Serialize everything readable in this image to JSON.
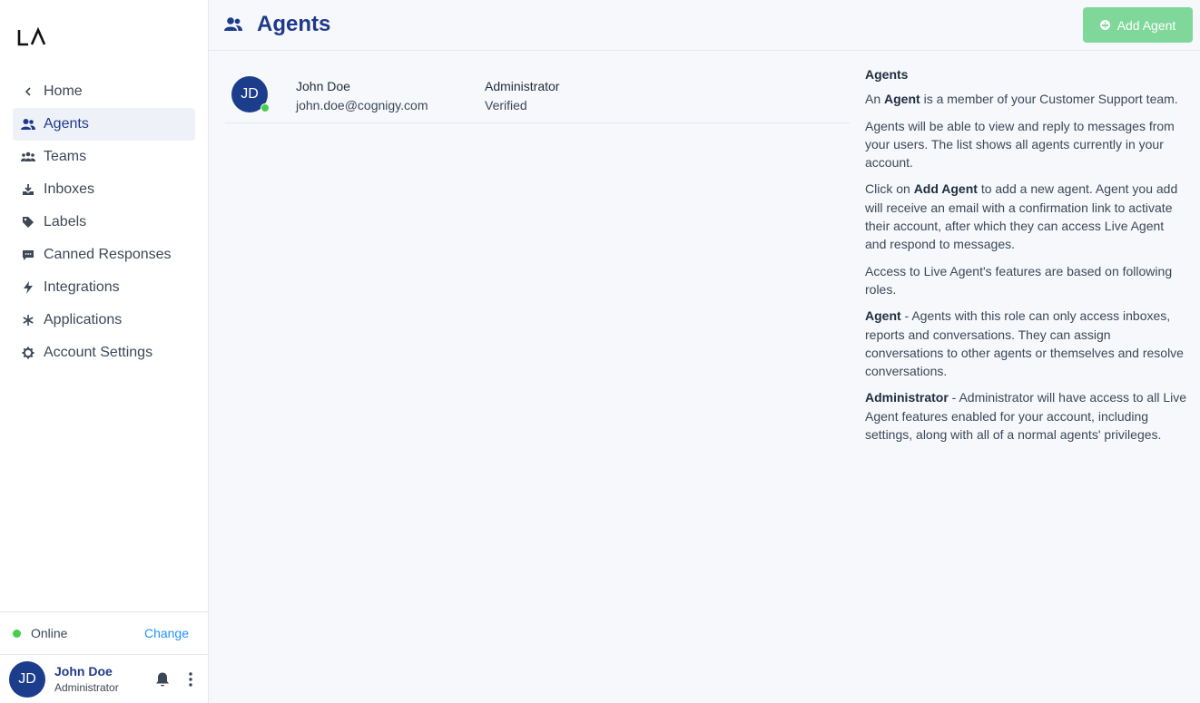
{
  "app": {
    "logo_text": "LA"
  },
  "sidebar": {
    "items": [
      {
        "label": "Home",
        "icon": "chevron-left-icon"
      },
      {
        "label": "Agents",
        "icon": "users-icon",
        "active": true
      },
      {
        "label": "Teams",
        "icon": "teams-icon"
      },
      {
        "label": "Inboxes",
        "icon": "inbox-icon"
      },
      {
        "label": "Labels",
        "icon": "tag-icon"
      },
      {
        "label": "Canned Responses",
        "icon": "chat-icon"
      },
      {
        "label": "Integrations",
        "icon": "bolt-icon"
      },
      {
        "label": "Applications",
        "icon": "asterisk-icon"
      },
      {
        "label": "Account Settings",
        "icon": "gear-icon"
      }
    ],
    "status": {
      "text": "Online",
      "change_label": "Change",
      "color": "#44ce4b"
    },
    "user": {
      "initials": "JD",
      "name": "John Doe",
      "role": "Administrator"
    }
  },
  "header": {
    "title": "Agents",
    "add_button_label": "Add Agent",
    "accent": "#1f3a8a",
    "button_color": "#7fd89a"
  },
  "agents": [
    {
      "initials": "JD",
      "name": "John Doe",
      "email": "john.doe@cognigy.com",
      "role": "Administrator",
      "status": "Verified"
    }
  ],
  "help": {
    "title": "Agents",
    "p1_pre": "An ",
    "p1_bold": "Agent",
    "p1_post": " is a member of your Customer Support team.",
    "p2": "Agents will be able to view and reply to messages from your users. The list shows all agents currently in your account.",
    "p3_pre": "Click on ",
    "p3_bold": "Add Agent",
    "p3_post": " to add a new agent. Agent you add will receive an email with a confirmation link to activate their account, after which they can access Live Agent and respond to messages.",
    "p4": "Access to Live Agent's features are based on following roles.",
    "p5_bold": "Agent",
    "p5_post": " - Agents with this role can only access inboxes, reports and conversations. They can assign conversations to other agents or themselves and resolve conversations.",
    "p6_bold": "Administrator",
    "p6_post": " - Administrator will have access to all Live Agent features enabled for your account, including settings, along with all of a normal agents' privileges."
  }
}
